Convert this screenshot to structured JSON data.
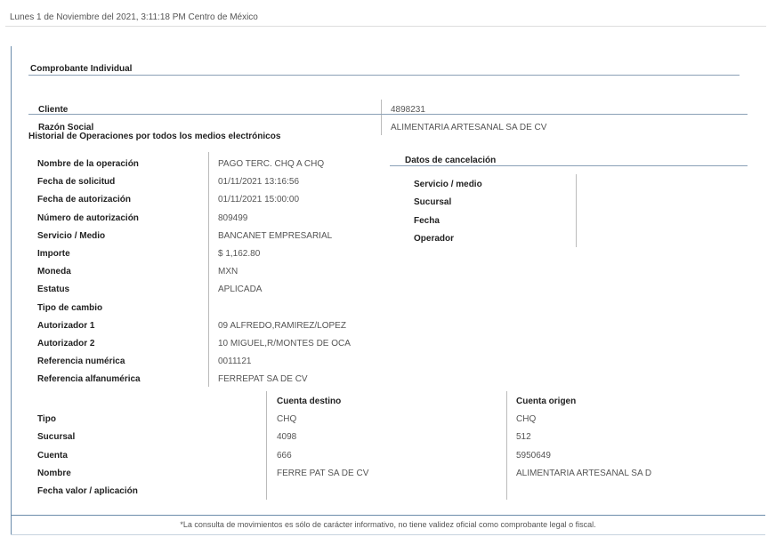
{
  "header": {
    "timestamp": "Lunes 1 de Noviembre del 2021, 3:11:18 PM Centro de México"
  },
  "receipt": {
    "title": "Comprobante Individual"
  },
  "client": {
    "cliente_label": "Cliente",
    "cliente_value": "4898231",
    "razon_label": "Razón Social",
    "razon_value": "ALIMENTARIA ARTESANAL SA DE CV"
  },
  "historial_title": "Historial de Operaciones por todos los medios electrónicos",
  "operation": [
    {
      "label": "Nombre de la operación",
      "value": "PAGO TERC. CHQ A CHQ"
    },
    {
      "label": "Fecha de solicitud",
      "value": "01/11/2021  13:16:56"
    },
    {
      "label": "Fecha de autorización",
      "value": "01/11/2021  15:00:00"
    },
    {
      "label": "Número de autorización",
      "value": "809499"
    },
    {
      "label": "Servicio / Medio",
      "value": "BANCANET EMPRESARIAL"
    },
    {
      "label": "Importe",
      "value": "$ 1,162.80"
    },
    {
      "label": "Moneda",
      "value": "MXN"
    },
    {
      "label": "Estatus",
      "value": "APLICADA"
    },
    {
      "label": "Tipo de cambio",
      "value": ""
    },
    {
      "label": "Autorizador 1",
      "value": "09 ALFREDO,RAMIREZ/LOPEZ"
    },
    {
      "label": "Autorizador 2",
      "value": "10 MIGUEL,R/MONTES DE OCA"
    },
    {
      "label": "Referencia numérica",
      "value": "0011121"
    },
    {
      "label": "Referencia alfanumérica",
      "value": "FERREPAT SA DE CV"
    }
  ],
  "cancel": {
    "title": "Datos de cancelación",
    "rows": [
      {
        "label": "Servicio / medio",
        "value": ""
      },
      {
        "label": "Sucursal",
        "value": ""
      },
      {
        "label": "Fecha",
        "value": ""
      },
      {
        "label": "Operador",
        "value": ""
      }
    ]
  },
  "accounts": {
    "dest_header": "Cuenta destino",
    "orig_header": "Cuenta origen",
    "rows": [
      {
        "label": "Tipo",
        "dest": "CHQ",
        "orig": "CHQ"
      },
      {
        "label": "Sucursal",
        "dest": "4098",
        "orig": "512"
      },
      {
        "label": "Cuenta",
        "dest": "666",
        "orig": "5950649"
      },
      {
        "label": "Nombre",
        "dest": "FERRE PAT SA DE CV",
        "orig": "ALIMENTARIA ARTESANAL SA D"
      },
      {
        "label": "Fecha valor / aplicación",
        "dest": "",
        "orig": ""
      }
    ]
  },
  "footer": {
    "note": "*La consulta de movimientos es sólo de carácter informativo, no tiene validez oficial como comprobante legal o fiscal."
  }
}
